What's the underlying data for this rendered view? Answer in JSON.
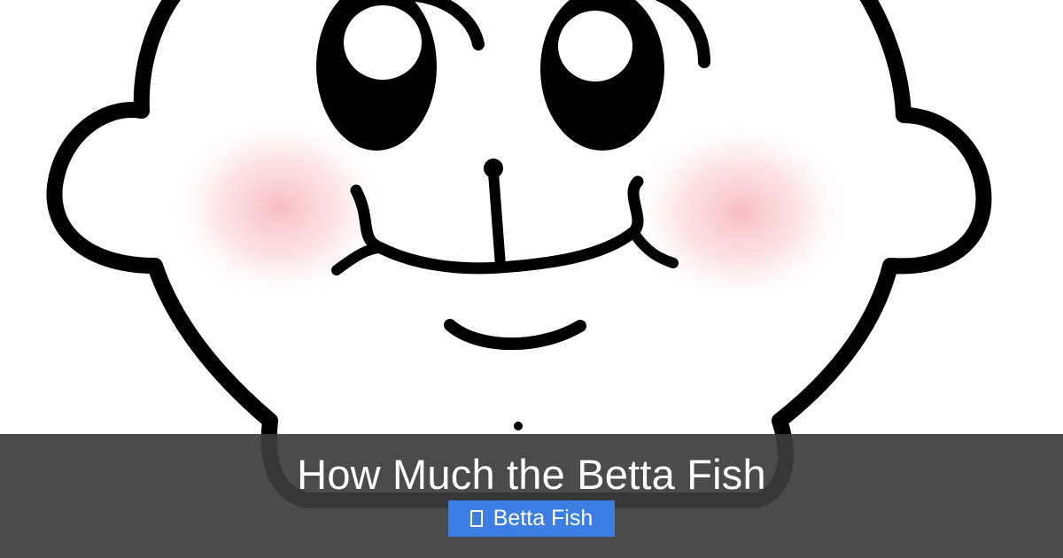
{
  "hero": {
    "title": "How Much the Betta Fish",
    "category": {
      "label": "Betta Fish",
      "icon": "folder-icon",
      "color": "#3d7ee5"
    },
    "illustration": "cartoon-face-illustration",
    "overlay_color": "#3c3c3c"
  }
}
